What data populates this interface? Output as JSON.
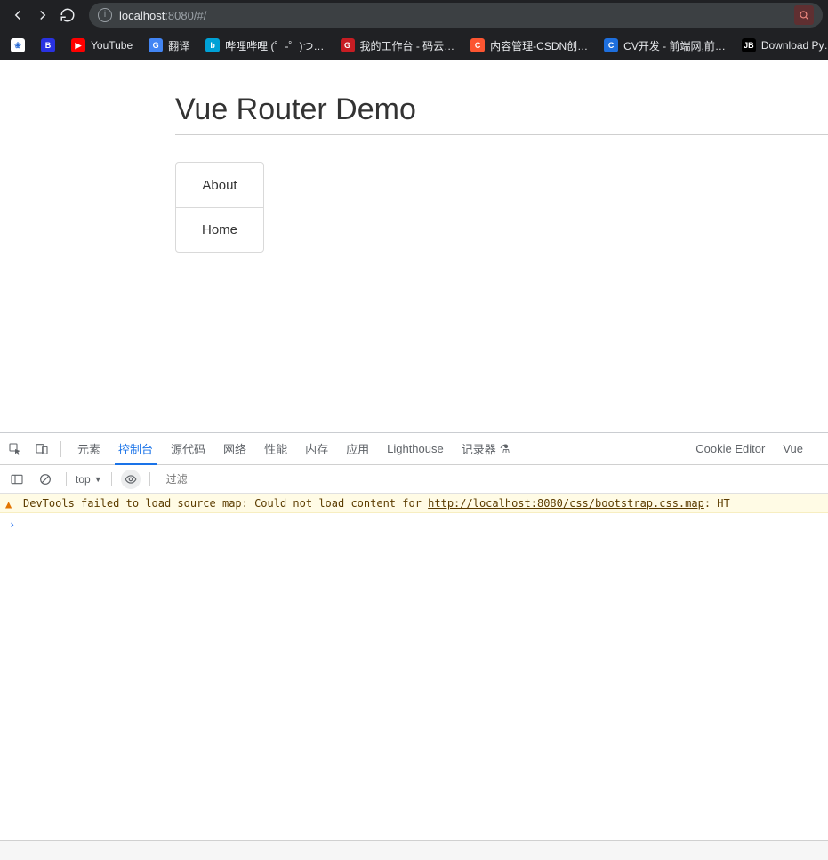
{
  "browser": {
    "url_host": "localhost",
    "url_port": ":8080",
    "url_path": "/#/"
  },
  "bookmarks": [
    {
      "label": "",
      "icon_bg": "#ffffff",
      "icon_fg": "#2a6bd4",
      "glyph": "❀"
    },
    {
      "label": "",
      "icon_bg": "#2932e1",
      "icon_fg": "#ffffff",
      "glyph": "B"
    },
    {
      "label": "YouTube",
      "icon_bg": "#ff0000",
      "icon_fg": "#ffffff",
      "glyph": "▶"
    },
    {
      "label": "翻译",
      "icon_bg": "#4285f4",
      "icon_fg": "#ffffff",
      "glyph": "G"
    },
    {
      "label": "哔哩哔哩 (゜-゜)つ…",
      "icon_bg": "#00a1d6",
      "icon_fg": "#ffffff",
      "glyph": "b"
    },
    {
      "label": "我的工作台 - 码云…",
      "icon_bg": "#c71d23",
      "icon_fg": "#ffffff",
      "glyph": "G"
    },
    {
      "label": "内容管理-CSDN创…",
      "icon_bg": "#fc5531",
      "icon_fg": "#ffffff",
      "glyph": "C"
    },
    {
      "label": "CV开发 - 前端网,前…",
      "icon_bg": "#1e6fde",
      "icon_fg": "#ffffff",
      "glyph": "C"
    },
    {
      "label": "Download Py…",
      "icon_bg": "#000000",
      "icon_fg": "#ffffff",
      "glyph": "JB"
    }
  ],
  "page": {
    "title": "Vue Router Demo",
    "nav_items": [
      "About",
      "Home"
    ]
  },
  "devtools": {
    "tabs": [
      "元素",
      "控制台",
      "源代码",
      "网络",
      "性能",
      "内存",
      "应用",
      "Lighthouse",
      "记录器"
    ],
    "active_tab_index": 1,
    "right_tabs": [
      "Cookie Editor",
      "Vue"
    ],
    "context": "top",
    "filter_placeholder": "过滤",
    "warning_prefix": "DevTools failed to load source map: Could not load content for ",
    "warning_url": "http://localhost:8080/css/bootstrap.css.map",
    "warning_suffix": ": HT",
    "prompt": "›"
  }
}
